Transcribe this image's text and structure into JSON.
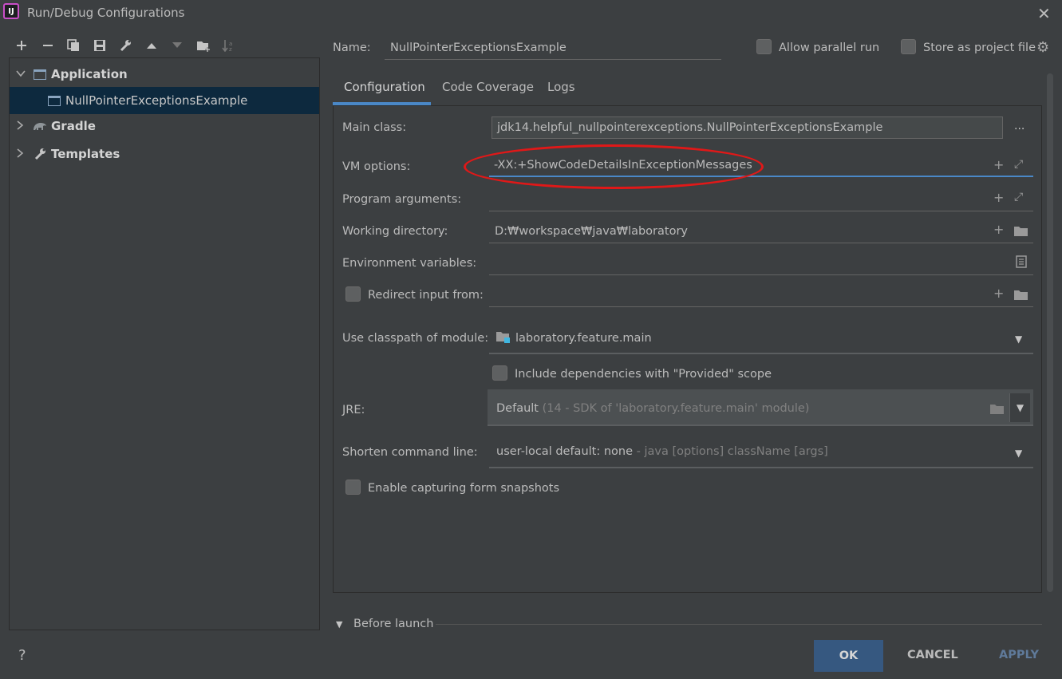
{
  "window": {
    "title": "Run/Debug Configurations",
    "app_icon_text": "IJ"
  },
  "toolbar": {
    "icons": [
      "add-icon",
      "remove-icon",
      "copy-icon",
      "save-icon",
      "wrench-icon",
      "move-up-icon",
      "move-down-icon",
      "new-folder-icon",
      "sort-icon"
    ]
  },
  "tree": {
    "items": [
      {
        "label": "Application",
        "icon": "application-icon",
        "expanded": true,
        "bold": true
      },
      {
        "label": "NullPointerExceptionsExample",
        "icon": "application-config-icon",
        "selected": true
      },
      {
        "label": "Gradle",
        "icon": "gradle-icon",
        "expanded": false,
        "bold": true
      },
      {
        "label": "Templates",
        "icon": "wrench-icon",
        "expanded": false,
        "bold": true
      }
    ]
  },
  "header": {
    "name_label": "Name:",
    "name_value": "NullPointerExceptionsExample",
    "allow_parallel_run": "Allow parallel run",
    "store_as_project_file": "Store as project file"
  },
  "tabs": [
    "Configuration",
    "Code Coverage",
    "Logs"
  ],
  "form": {
    "main_class": {
      "label": "Main class:",
      "value": "jdk14.helpful_nullpointerexceptions.NullPointerExceptionsExample",
      "button": "..."
    },
    "vm_options": {
      "label": "VM options:",
      "value": "-XX:+ShowCodeDetailsInExceptionMessages"
    },
    "program_arguments": {
      "label": "Program arguments:",
      "value": ""
    },
    "working_directory": {
      "label": "Working directory:",
      "value": "D:₩workspace₩java₩laboratory"
    },
    "environment_variables": {
      "label": "Environment variables:",
      "value": ""
    },
    "redirect_input": {
      "label": "Redirect input from:",
      "value": ""
    },
    "classpath_module": {
      "label": "Use classpath of module:",
      "value": "laboratory.feature.main"
    },
    "include_provided": {
      "label": "Include dependencies with \"Provided\" scope"
    },
    "jre": {
      "label": "JRE:",
      "value": "Default",
      "hint": "(14 - SDK of 'laboratory.feature.main' module)"
    },
    "shorten_command_line": {
      "label": "Shorten command line:",
      "value": "user-local default: none",
      "hint": "- java [options] className [args]"
    },
    "capture_snapshots": {
      "label": "Enable capturing form snapshots"
    }
  },
  "before_launch": {
    "label": "Before launch"
  },
  "footer": {
    "help": "?",
    "ok": "OK",
    "cancel": "CANCEL",
    "apply": "APPLY"
  },
  "colors": {
    "background": "#3c3f41",
    "selection": "#0d293e",
    "accent": "#4a88c7",
    "ok_button": "#365880",
    "highlight_oval": "#e01818"
  }
}
